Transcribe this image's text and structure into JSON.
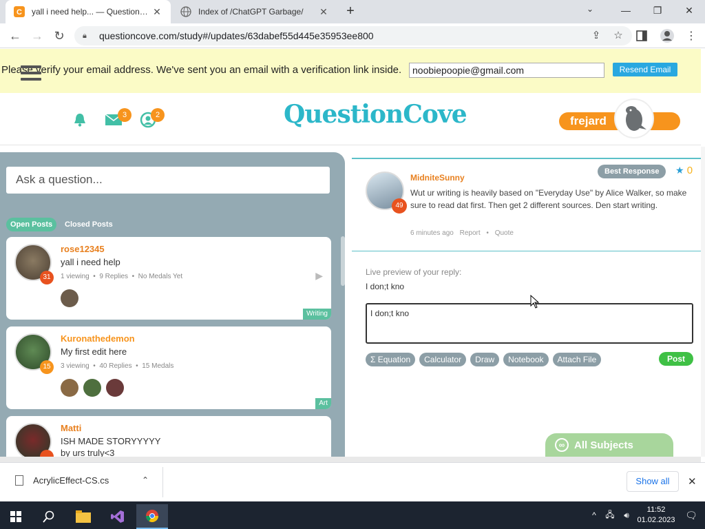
{
  "browser": {
    "tabs": [
      {
        "title": "yall i need help... — QuestionCove",
        "active": true
      },
      {
        "title": "Index of /ChatGPT Garbage/",
        "active": false
      }
    ],
    "url": "questioncove.com/study#/updates/63dabef55d445e35953ee800"
  },
  "banner": {
    "message": "Please verify your email address. We've sent you an email with a verification link inside.",
    "email": "noobiepoopie@gmail.com",
    "resend_label": "Resend Email"
  },
  "header": {
    "logo_text": "QuestionCove",
    "messages_count": "3",
    "friends_count": "2",
    "username": "frejard"
  },
  "left": {
    "ask_placeholder": "Ask a question...",
    "filters": {
      "open": "Open Posts",
      "closed": "Closed Posts"
    },
    "posts": [
      {
        "user": "rose12345",
        "level": "31",
        "question": "yall i need help",
        "viewing": "1 viewing",
        "replies": "9 Replies",
        "medals": "No Medals Yet",
        "tag": "Writing"
      },
      {
        "user": "Kuronathedemon",
        "level": "15",
        "question": "My first edit here",
        "viewing": "3 viewing",
        "replies": "40 Replies",
        "medals": "15 Medals",
        "tag": "Art"
      },
      {
        "user": "Matti",
        "level": "",
        "question": "ISH MADE STORYYYYY",
        "subline": "by urs truly<3"
      }
    ]
  },
  "thread": {
    "answer": {
      "user": "MidniteSunny",
      "level": "49",
      "text": "Wut ur writing is heavily based on \"Everyday Use\" by Alice Walker, so make sure to read dat first. Then get 2 different sources. Den start writing.",
      "time": "6 minutes ago",
      "report": "Report",
      "quote": "Quote",
      "best_label": "Best Response",
      "medal_count": "0"
    },
    "preview_label": "Live preview of your reply:",
    "preview_text": "I don;t kno",
    "reply_text": "I don;t kno",
    "tools": [
      "Σ  Equation",
      "Calculator",
      "Draw",
      "Notebook",
      "Attach File"
    ],
    "post_label": "Post"
  },
  "all_subjects": "All Subjects",
  "downloads": {
    "file": "AcrylicEffect-CS.cs",
    "show_all": "Show all"
  },
  "taskbar": {
    "time": "11:52",
    "date": "01.02.2023"
  },
  "colors": {
    "accent_orange": "#f7941d",
    "teal": "#5bc09f",
    "panel_gray": "#94aab3",
    "post_green": "#3fc045"
  }
}
